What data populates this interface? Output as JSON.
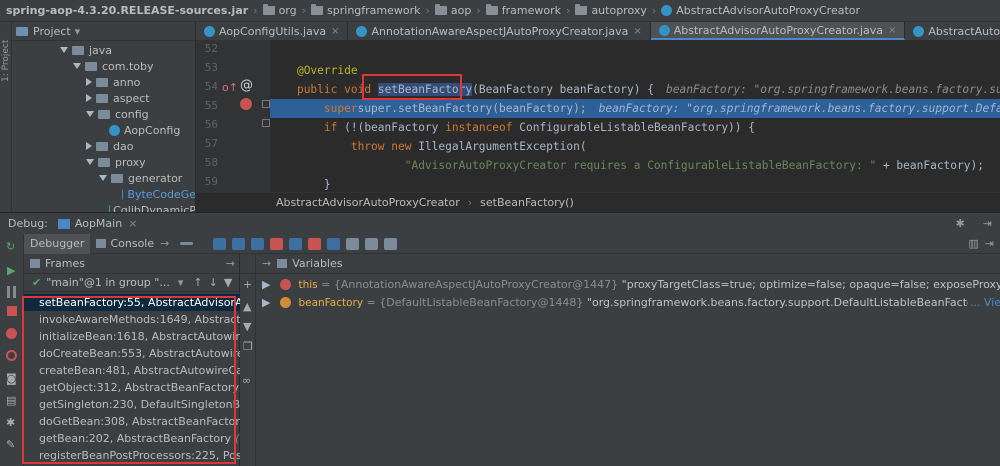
{
  "breadcrumb": [
    "spring-aop-4.3.20.RELEASE-sources.jar",
    "org",
    "springframework",
    "aop",
    "framework",
    "autoproxy",
    "AbstractAdvisorAutoProxyCreator"
  ],
  "left_strip": {
    "project_tab": "1: Project"
  },
  "project": {
    "title": "Project",
    "tree": [
      {
        "label": "java",
        "depth": 0,
        "kind": "folder",
        "expanded": true
      },
      {
        "label": "com.toby",
        "depth": 1,
        "kind": "package",
        "expanded": true
      },
      {
        "label": "anno",
        "depth": 2,
        "kind": "package",
        "expanded": false
      },
      {
        "label": "aspect",
        "depth": 2,
        "kind": "package",
        "expanded": false
      },
      {
        "label": "config",
        "depth": 2,
        "kind": "package",
        "expanded": true
      },
      {
        "label": "AopConfig",
        "depth": 3,
        "kind": "class"
      },
      {
        "label": "dao",
        "depth": 2,
        "kind": "package",
        "expanded": false
      },
      {
        "label": "proxy",
        "depth": 2,
        "kind": "package",
        "expanded": true
      },
      {
        "label": "generator",
        "depth": 3,
        "kind": "package",
        "expanded": true
      },
      {
        "label": "ByteCodeGe",
        "depth": 4,
        "kind": "class"
      },
      {
        "label": "CglibDynamicP",
        "depth": 3,
        "kind": "class"
      }
    ]
  },
  "editor": {
    "tabs": [
      {
        "label": "AopConfigUtils.java",
        "active": false
      },
      {
        "label": "AnnotationAwareAspectJAutoProxyCreator.java",
        "active": false
      },
      {
        "label": "AbstractAdvisorAutoProxyCreator.java",
        "active": true
      },
      {
        "label": "AbstractAutowireCapableBeanFactory.java",
        "active": false
      }
    ],
    "line_numbers": [
      "52",
      "53",
      "54",
      "55",
      "56",
      "57",
      "58",
      "59",
      "60"
    ],
    "lines": {
      "l53": "@Override",
      "l54_kw1": "public",
      "l54_kw2": "void",
      "l54_method": "setBeanFactory",
      "l54_rest": "(BeanFactory beanFactory) {",
      "l54_hint": "beanFactory: \"org.springframework.beans.factory.support.DefaultListableBeanFactory\"",
      "l55_code": "super.setBeanFactory(beanFactory);",
      "l55_hint": "beanFactory: \"org.springframework.beans.factory.support.DefaultListableBeanFactory\"",
      "l56_kw1": "if",
      "l56_a": " (!(beanFactory ",
      "l56_kw2": "instanceof",
      "l56_b": " ConfigurableListableBeanFactory)) {",
      "l57_kw": "throw new",
      "l57_b": " IllegalArgumentException(",
      "l58_str": "\"AdvisorAutoProxyCreator requires a ConfigurableListableBeanFactory: \"",
      "l58_b": " + beanFactory);",
      "l59": "}"
    },
    "breadcrumb": [
      "AbstractAdvisorAutoProxyCreator",
      "setBeanFactory()"
    ]
  },
  "debug": {
    "label": "Debug:",
    "run_config": "AopMain",
    "tabs": [
      "Debugger",
      "Console"
    ],
    "frames_title": "Frames",
    "variables_title": "Variables",
    "thread": "\"main\"@1 in group \"...",
    "frames": [
      {
        "method": "setBeanFactory:55, AbstractAdvisorAutoProxyCreator",
        "pkg": "",
        "selected": true
      },
      {
        "method": "invokeAwareMethods:1649, AbstractAutowireCapableBeanFactory",
        "pkg": ""
      },
      {
        "method": "initializeBean:1618, AbstractAutowireCapableBeanFactory",
        "pkg": ""
      },
      {
        "method": "doCreateBean:553, AbstractAutowireCapableBeanFactory",
        "pkg": ""
      },
      {
        "method": "createBean:481, AbstractAutowireCapableBeanFactory",
        "pkg": ""
      },
      {
        "method": "getObject:312, AbstractBeanFactory$1",
        "pkg": "(org.springframework.beans.factory.support)"
      },
      {
        "method": "getSingleton:230, DefaultSingletonBeanRegistry",
        "pkg": ""
      },
      {
        "method": "doGetBean:308, AbstractBeanFactory",
        "pkg": "(org.springframework.beans.factory.support)"
      },
      {
        "method": "getBean:202, AbstractBeanFactory",
        "pkg": "(org.springframework.beans.factory.support)"
      },
      {
        "method": "registerBeanPostProcessors:225, PostProcessorRegistrationDelegate",
        "pkg": ""
      }
    ],
    "variables": [
      {
        "name": "this",
        "ref": "{AnnotationAwareAspectJAutoProxyCreator@1447}",
        "value": "\"proxyTargetClass=true; optimize=false; opaque=false; exposeProxy=false; frozen=false\"",
        "icon": "red"
      },
      {
        "name": "beanFactory",
        "ref": "{DefaultListableBeanFactory@1448}",
        "value": "\"org.springframework.beans.factory.support.DefaultListableBeanFactory@5b0abc94: defining beans [org.springframework.context.annotation.internalConfigurationAnnotationProcessor\"",
        "link": "... View",
        "icon": "orange"
      }
    ]
  }
}
